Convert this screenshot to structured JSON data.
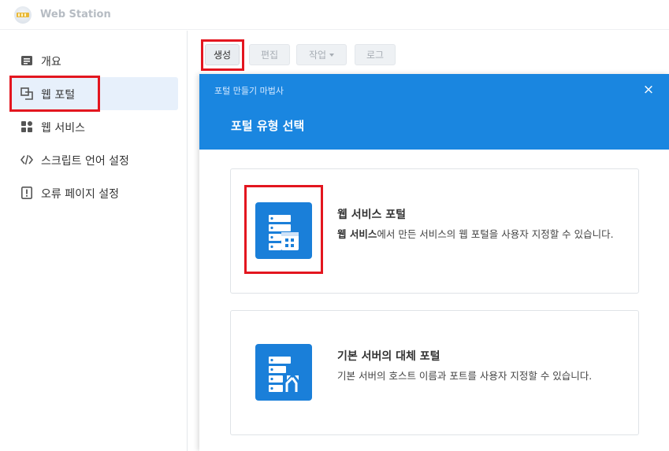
{
  "window": {
    "title": "Web Station"
  },
  "sidebar": {
    "items": [
      {
        "label": "개요",
        "icon": "overview-icon"
      },
      {
        "label": "웹 포털",
        "icon": "web-portal-icon"
      },
      {
        "label": "웹 서비스",
        "icon": "web-service-icon"
      },
      {
        "label": "스크립트 언어 설정",
        "icon": "code-icon"
      },
      {
        "label": "오류 페이지 설정",
        "icon": "error-page-icon"
      }
    ],
    "active": "웹 포털"
  },
  "toolbar": {
    "create_label": "생성",
    "edit_label": "편집",
    "action_label": "작업",
    "log_label": "로그"
  },
  "dialog": {
    "wizard_title": "포털 만들기 마법사",
    "heading": "포털 유형 선택",
    "close": "×",
    "options": [
      {
        "title": "웹 서비스 포털",
        "desc_bold": "웹 서비스",
        "desc_rest": "에서 만든 서비스의 웹 포털을 사용자 지정할 수 있습니다.",
        "icon": "web-service-portal-icon"
      },
      {
        "title": "기본 서버의 대체 포털",
        "desc": "기본 서버의 호스트 이름과 포트를 사용자 지정할 수 있습니다.",
        "icon": "alias-portal-icon"
      }
    ]
  },
  "colors": {
    "accent": "#1a86e0",
    "highlight": "#e3161f",
    "active_nav": "#e7f0fb"
  }
}
